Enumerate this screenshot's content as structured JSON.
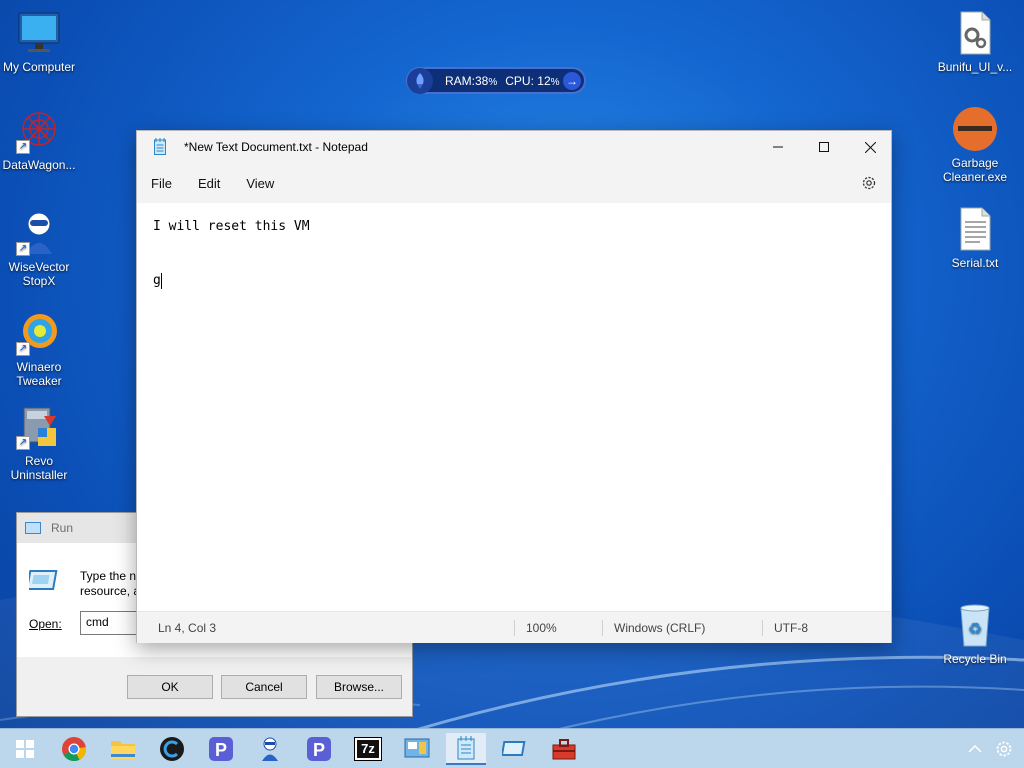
{
  "desktop": {
    "icons_left": [
      {
        "label": "My Computer",
        "icon": "monitor-icon"
      },
      {
        "label": "DataWagon...",
        "icon": "datawagon-icon"
      },
      {
        "label": "WiseVector StopX",
        "icon": "wisevector-icon"
      },
      {
        "label": "Winaero Tweaker",
        "icon": "winaero-icon"
      },
      {
        "label": "Revo Uninstaller",
        "icon": "revo-icon"
      }
    ],
    "icons_right": [
      {
        "label": "Bunifu_UI_v...",
        "icon": "settings-file-icon"
      },
      {
        "label": "Garbage Cleaner.exe",
        "icon": "garbage-cleaner-icon"
      },
      {
        "label": "Serial.txt",
        "icon": "text-file-icon"
      },
      {
        "label": "Recycle Bin",
        "icon": "recycle-bin-icon"
      }
    ]
  },
  "widget": {
    "ram": "RAM:38",
    "ram_unit": "%",
    "cpu": "CPU: 12",
    "cpu_unit": "%"
  },
  "run_dialog": {
    "title": "Run",
    "description_line1": "Type the na",
    "description_line2": "resource, a",
    "open_label": "Open:",
    "open_value": "cmd",
    "ok_label": "OK",
    "cancel_label": "Cancel",
    "browse_label": "Browse..."
  },
  "notepad": {
    "title": "*New Text Document.txt - Notepad",
    "menu": [
      "File",
      "Edit",
      "View"
    ],
    "content_line1": "I will reset this VM",
    "content_line4": "g",
    "status": {
      "position": "Ln 4, Col 3",
      "zoom": "100%",
      "line_ending": "Windows (CRLF)",
      "encoding": "UTF-8"
    }
  },
  "taskbar": {
    "items": [
      {
        "name": "start-button",
        "icon": "windows-logo-icon"
      },
      {
        "name": "chrome",
        "icon": "chrome-icon"
      },
      {
        "name": "file-explorer",
        "icon": "folder-icon"
      },
      {
        "name": "ccleaner",
        "icon": "ccleaner-icon"
      },
      {
        "name": "app-p1",
        "icon": "p-app-icon"
      },
      {
        "name": "wisevector",
        "icon": "wisevector-icon"
      },
      {
        "name": "app-p2",
        "icon": "p-app-icon"
      },
      {
        "name": "7zip",
        "icon": "7zip-icon"
      },
      {
        "name": "control-panel",
        "icon": "control-panel-icon"
      },
      {
        "name": "notepad",
        "icon": "notepad-icon"
      },
      {
        "name": "run",
        "icon": "run-icon"
      },
      {
        "name": "toolbox",
        "icon": "toolbox-icon"
      }
    ],
    "seven_zip_label": "7z"
  }
}
